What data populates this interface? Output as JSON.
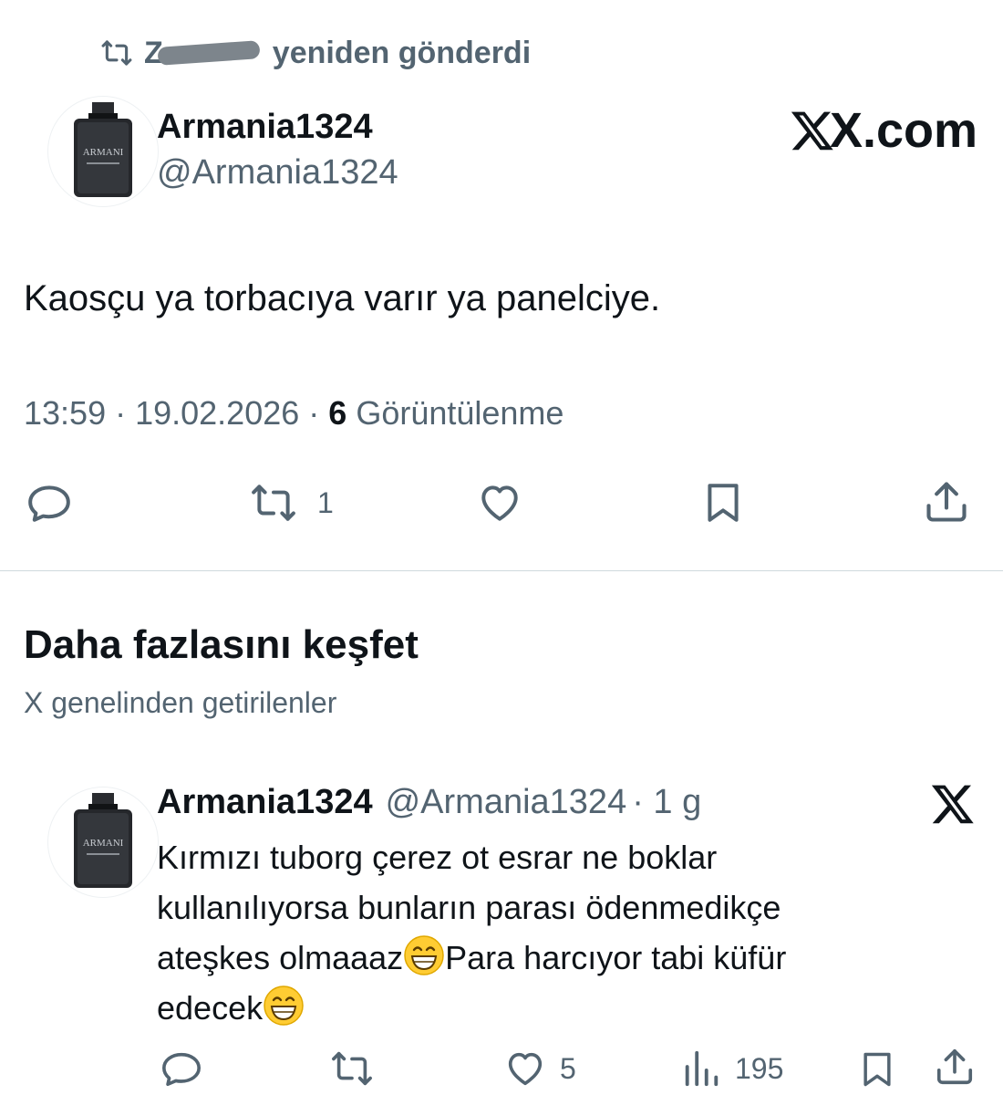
{
  "repost": {
    "prefix": "Z",
    "suffix": "yeniden gönderdi"
  },
  "tweet": {
    "author_name": "Armania1324",
    "author_handle": "@Armania1324",
    "avatar_brand": "ARMANI",
    "site_label": "X.com",
    "text": "Kaosçu ya torbacıya varır ya panelciye.",
    "time": "13:59",
    "separator": "·",
    "date": "19.02.2026",
    "views_count": "6",
    "views_label": "Görüntülenme",
    "actions": {
      "reply_icon": "reply-icon",
      "repost_icon": "repost-icon",
      "repost_count": "1",
      "like_icon": "heart-icon",
      "bookmark_icon": "bookmark-icon",
      "share_icon": "share-icon"
    }
  },
  "explore": {
    "title": "Daha fazlasını keşfet",
    "subtitle": "X genelinden getirilenler"
  },
  "recommended": {
    "author_name": "Armania1324",
    "author_handle": "@Armania1324",
    "age": "· 1 g",
    "avatar_brand": "ARMANI",
    "text_line1": "Kırmızı tuborg çerez ot esrar ne boklar",
    "text_line2": "kullanılıyorsa bunların parası ödenmedikçe",
    "text_line3a": "ateşkes olmaaaz",
    "text_line3b": "Para harcıyor tabi küfür",
    "text_line4": "edecek",
    "actions": {
      "like_count": "5",
      "views_count": "195"
    }
  },
  "colors": {
    "text_primary": "#0f1419",
    "text_secondary": "#536471",
    "divider": "#cfd9de",
    "background": "#ffffff"
  }
}
